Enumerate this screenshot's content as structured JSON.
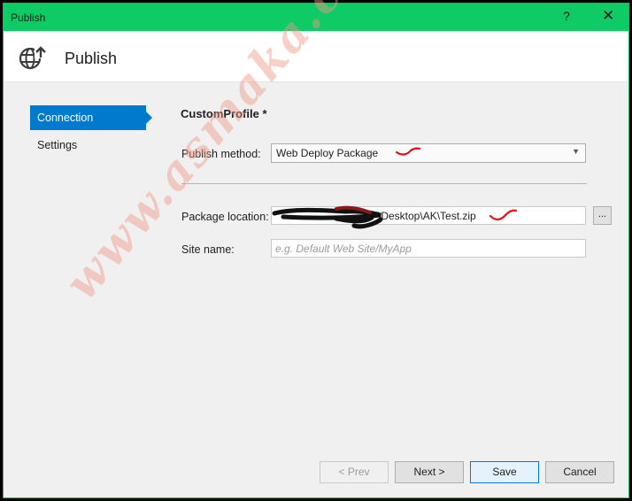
{
  "window": {
    "title": "Publish",
    "help_glyph": "?",
    "close_glyph": "✕"
  },
  "header": {
    "title": "Publish",
    "icon": "globe-publish-icon"
  },
  "nav": {
    "items": [
      {
        "label": "Connection",
        "active": true
      },
      {
        "label": "Settings",
        "active": false
      }
    ]
  },
  "form": {
    "profile_name": "CustomProfile *",
    "publish_method_label": "Publish method:",
    "publish_method_value": "Web Deploy Package",
    "package_location_label": "Package location:",
    "package_location_value": "\\Desktop\\AK\\Test.zip",
    "browse_label": "...",
    "site_name_label": "Site name:",
    "site_name_placeholder": "e.g. Default Web Site/MyApp"
  },
  "buttons": {
    "prev": "< Prev",
    "next": "Next >",
    "save": "Save",
    "cancel": "Cancel"
  },
  "watermark": {
    "text": "www.asmaka.com"
  },
  "colors": {
    "titlebar": "#0fcb65",
    "accent": "#007acc",
    "annotation_red": "#e0101a"
  }
}
